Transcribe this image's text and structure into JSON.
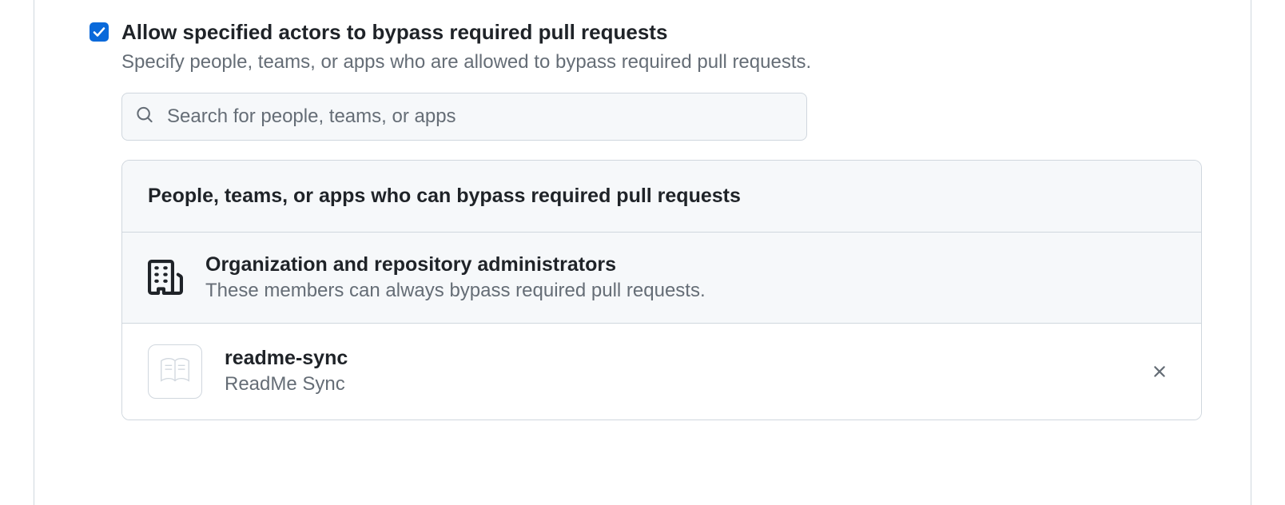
{
  "option": {
    "title": "Allow specified actors to bypass required pull requests",
    "description": "Specify people, teams, or apps who are allowed to bypass required pull requests."
  },
  "search": {
    "placeholder": "Search for people, teams, or apps"
  },
  "panel": {
    "header": "People, teams, or apps who can bypass required pull requests"
  },
  "rows": {
    "admins": {
      "title": "Organization and repository administrators",
      "subtitle": "These members can always bypass required pull requests."
    },
    "app": {
      "title": "readme-sync",
      "subtitle": "ReadMe Sync"
    }
  }
}
